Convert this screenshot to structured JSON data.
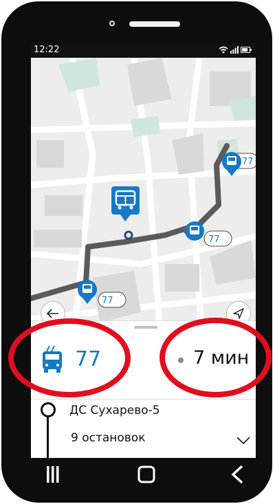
{
  "status_bar": {
    "time": "12:22"
  },
  "map": {
    "route_color": "#5a5a5a",
    "accent": "#1679c6",
    "markers": [
      {
        "label": "77"
      },
      {
        "label": "77"
      },
      {
        "label": "77"
      }
    ]
  },
  "map_controls": {
    "back_icon": "arrow-left-icon",
    "locate_icon": "navigation-arrow-icon"
  },
  "route_card": {
    "route_number": "77",
    "vehicle_icon": "trolleybus-icon",
    "eta": "7 мин",
    "highlight_color": "#e20d1e"
  },
  "stop": {
    "name": "ДС Сухарево-5",
    "stops_count": "9 остановок"
  },
  "nav_bar": {
    "buttons": [
      "recent-apps",
      "home",
      "back"
    ]
  }
}
